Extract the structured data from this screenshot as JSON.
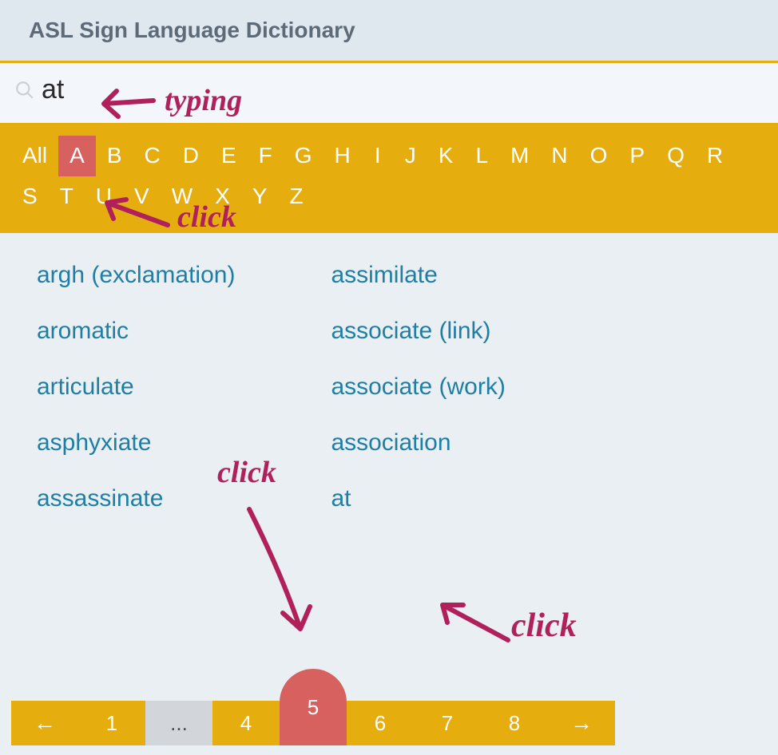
{
  "header": {
    "title": "ASL Sign Language Dictionary"
  },
  "search": {
    "value": "at"
  },
  "alpha": {
    "items": [
      "All",
      "A",
      "B",
      "C",
      "D",
      "E",
      "F",
      "G",
      "H",
      "I",
      "J",
      "K",
      "L",
      "M",
      "N",
      "O",
      "P",
      "Q",
      "R",
      "S",
      "T",
      "U",
      "V",
      "W",
      "X",
      "Y",
      "Z"
    ],
    "active": "A"
  },
  "results": {
    "col1": [
      "argh (exclamation)",
      "aromatic",
      "articulate",
      "asphyxiate",
      "assassinate"
    ],
    "col2": [
      "assimilate",
      "associate (link)",
      "associate (work)",
      "association",
      "at"
    ]
  },
  "pager": {
    "prev": "←",
    "next": "→",
    "items": [
      {
        "label": "1",
        "type": "num"
      },
      {
        "label": "...",
        "type": "ellipsis"
      },
      {
        "label": "4",
        "type": "num"
      },
      {
        "label": "5",
        "type": "current"
      },
      {
        "label": "6",
        "type": "num"
      },
      {
        "label": "7",
        "type": "num"
      },
      {
        "label": "8",
        "type": "num"
      }
    ]
  },
  "annotations": {
    "typing": "typing",
    "click1": "click",
    "click2": "click",
    "click3": "click"
  }
}
